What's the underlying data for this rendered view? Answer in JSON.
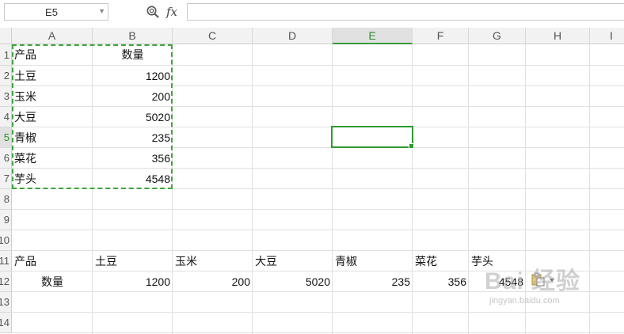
{
  "formula_bar": {
    "name_box": "E5",
    "fx_label": "fx",
    "formula_value": ""
  },
  "columns": [
    "A",
    "B",
    "C",
    "D",
    "E",
    "F",
    "G",
    "H",
    "I"
  ],
  "rows": [
    "1",
    "2",
    "3",
    "4",
    "5",
    "6",
    "7",
    "8",
    "9",
    "10",
    "11",
    "12",
    "13",
    "14"
  ],
  "selected": {
    "column": "E",
    "row": "5"
  },
  "table_vertical": {
    "header": [
      "产品",
      "数量"
    ],
    "rows": [
      [
        "土豆",
        "1200"
      ],
      [
        "玉米",
        "200"
      ],
      [
        "大豆",
        "5020"
      ],
      [
        "青椒",
        "235"
      ],
      [
        "菜花",
        "356"
      ],
      [
        "芋头",
        "4548"
      ]
    ]
  },
  "table_transposed": {
    "row11": [
      "产品",
      "土豆",
      "玉米",
      "大豆",
      "青椒",
      "菜花",
      "芋头"
    ],
    "row12": [
      "数量",
      "1200",
      "200",
      "5020",
      "235",
      "356",
      "4548"
    ]
  },
  "watermark": {
    "text": "Bai 经验",
    "sub": "jingyan.baidu.com"
  },
  "colors": {
    "selection_green": "#2f9a2f",
    "header_bg": "#f2f2f2",
    "grid_line": "#e0e0e0"
  },
  "icons": {
    "zoom": "magnify-search-icon",
    "paste": "paste-options-icon"
  }
}
